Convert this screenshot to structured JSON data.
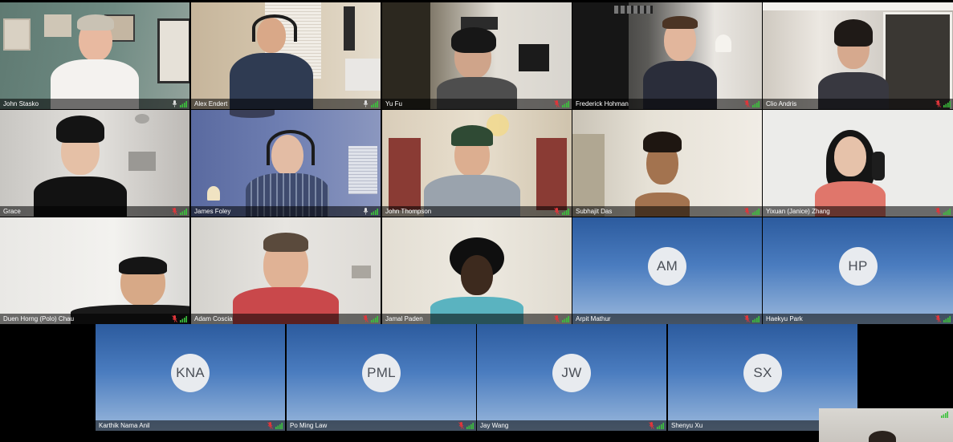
{
  "meeting": {
    "colors": {
      "active_speaker_border": "#3cc23c",
      "avatar_background": "#3b6aae",
      "muted_mic": "#e0363b",
      "signal": "#3cc23c"
    },
    "tiles": [
      {
        "name": "John Stasko",
        "mic": "unmuted",
        "active": true
      },
      {
        "name": "Alex Endert",
        "mic": "unmuted"
      },
      {
        "name": "Yu Fu",
        "mic": "muted"
      },
      {
        "name": "Frederick Hohman",
        "mic": "muted"
      },
      {
        "name": "Clio Andris",
        "mic": "muted"
      },
      {
        "name": "Grace",
        "mic": "muted"
      },
      {
        "name": "James Foley",
        "mic": "unmuted"
      },
      {
        "name": "John Thompson",
        "mic": "muted"
      },
      {
        "name": "Subhajit Das",
        "mic": "muted"
      },
      {
        "name": "Yixuan (Janice) Zhang",
        "mic": "muted"
      },
      {
        "name": "Duen Horng (Polo) Chau",
        "mic": "muted"
      },
      {
        "name": "Adam Coscia",
        "mic": "muted"
      },
      {
        "name": "Jamal Paden",
        "mic": "muted"
      },
      {
        "name": "Arpit Mathur",
        "mic": "muted",
        "initials": "AM"
      },
      {
        "name": "Haekyu Park",
        "mic": "muted",
        "initials": "HP"
      },
      {
        "name": "Karthik Nama Anil",
        "mic": "muted",
        "initials": "KNA"
      },
      {
        "name": "Po Ming Law",
        "mic": "muted",
        "initials": "PML"
      },
      {
        "name": "Jay Wang",
        "mic": "muted",
        "initials": "JW"
      },
      {
        "name": "Shenyu Xu",
        "mic": "muted",
        "initials": "SX"
      }
    ]
  }
}
